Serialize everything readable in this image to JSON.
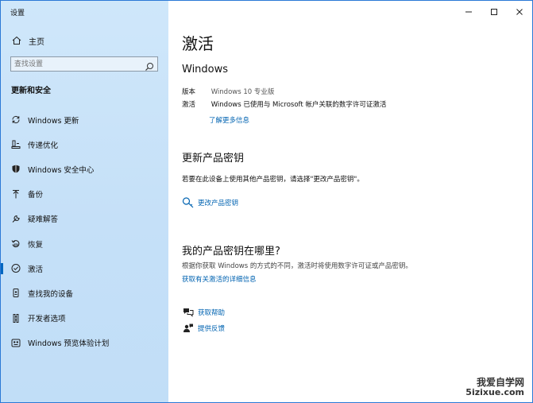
{
  "window": {
    "title": "设置"
  },
  "sidebar": {
    "home_label": "主页",
    "search_placeholder": "查找设置",
    "section_title": "更新和安全",
    "items": [
      {
        "label": "Windows 更新",
        "icon": "sync-icon"
      },
      {
        "label": "传递优化",
        "icon": "delivery-optimization-icon"
      },
      {
        "label": "Windows 安全中心",
        "icon": "shield-icon"
      },
      {
        "label": "备份",
        "icon": "backup-arrow-icon"
      },
      {
        "label": "疑难解答",
        "icon": "wrench-icon"
      },
      {
        "label": "恢复",
        "icon": "recovery-icon"
      },
      {
        "label": "激活",
        "icon": "check-circle-icon",
        "active": true
      },
      {
        "label": "查找我的设备",
        "icon": "find-device-icon"
      },
      {
        "label": "开发者选项",
        "icon": "developer-icon"
      },
      {
        "label": "Windows 预览体验计划",
        "icon": "insider-icon"
      }
    ]
  },
  "main": {
    "title": "激活",
    "windows": {
      "heading": "Windows",
      "edition_key": "版本",
      "edition_value": "Windows 10 专业版",
      "activation_key": "激活",
      "activation_value": "Windows 已使用与 Microsoft 帐户关联的数字许可证激活",
      "learn_more": "了解更多信息"
    },
    "update_key": {
      "heading": "更新产品密钥",
      "description": "若要在此设备上使用其他产品密钥，请选择\"更改产品密钥\"。",
      "change_link": "更改产品密钥"
    },
    "where_key": {
      "heading": "我的产品密钥在哪里?",
      "description": "根据你获取 Windows 的方式的不同，激活时将使用数字许可证或产品密钥。",
      "details_link": "获取有关激活的详细信息"
    },
    "help": {
      "get_help": "获取帮助",
      "feedback": "提供反馈"
    }
  },
  "watermark": {
    "line1": "我爱自学网",
    "line2": "5izixue.com"
  },
  "colors": {
    "accent": "#0067c0",
    "link": "#0063b1",
    "sidebar_bg": "#c5e0f8"
  }
}
